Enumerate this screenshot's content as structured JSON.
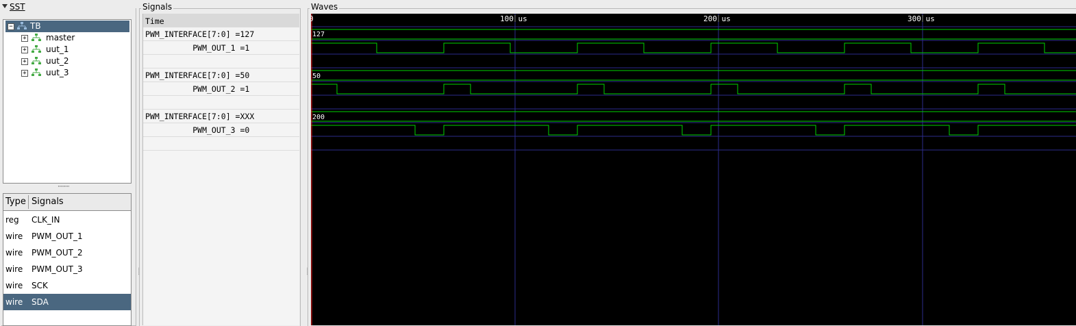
{
  "sst": {
    "title": "SST",
    "tree": [
      {
        "label": "TB",
        "expanded": true,
        "selected": true
      },
      {
        "label": "master"
      },
      {
        "label": "uut_1"
      },
      {
        "label": "uut_2"
      },
      {
        "label": "uut_3"
      }
    ],
    "list_headers": {
      "type": "Type",
      "signals": "Signals"
    },
    "list_rows": [
      {
        "type": "reg",
        "name": "CLK_IN"
      },
      {
        "type": "wire",
        "name": "PWM_OUT_1"
      },
      {
        "type": "wire",
        "name": "PWM_OUT_2"
      },
      {
        "type": "wire",
        "name": "PWM_OUT_3"
      },
      {
        "type": "wire",
        "name": "SCK"
      },
      {
        "type": "wire",
        "name": "SDA",
        "selected": true
      }
    ]
  },
  "signals": {
    "title": "Signals",
    "time_label": "Time",
    "rows": [
      "PWM_INTERFACE[7:0] =127",
      "          PWM_OUT_1 =1",
      "PWM_INTERFACE[7:0] =50",
      "          PWM_OUT_2 =1",
      "PWM_INTERFACE[7:0] =XXX",
      "          PWM_OUT_3 =0"
    ]
  },
  "waves": {
    "title": "Waves",
    "time_labels": [
      "0",
      "100 us",
      "200 us",
      "300 us"
    ],
    "bus_values": [
      "127",
      "50",
      "200"
    ],
    "colors": {
      "signal": "#00d400",
      "grid": "#2c2c8c",
      "background": "#000000",
      "cursor": "#ff2020"
    }
  }
}
